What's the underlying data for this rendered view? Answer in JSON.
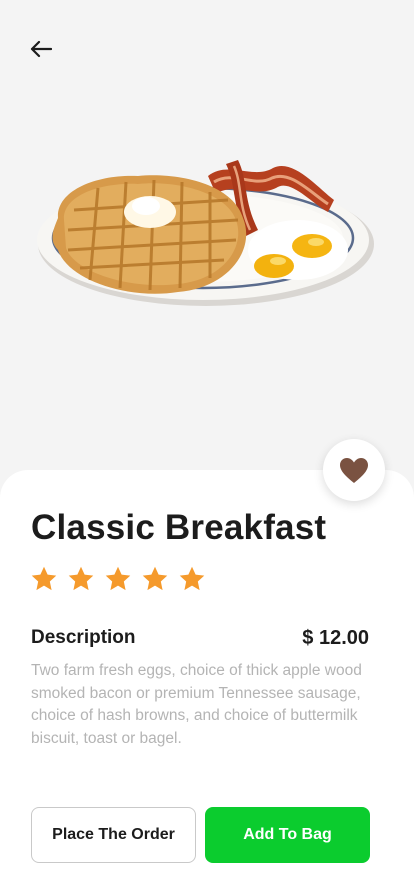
{
  "header": {
    "back_icon": "arrow-left-icon"
  },
  "product": {
    "title": "Classic Breakfast",
    "rating": 5,
    "rating_max": 5,
    "description_label": "Description",
    "price": "$ 12.00",
    "description": "Two farm fresh eggs, choice of thick apple wood smoked bacon or premium Tennessee sausage, choice of hash browns, and choice of buttermilk biscuit, toast or bagel."
  },
  "favorite": {
    "icon": "heart-icon",
    "color": "#7a5241"
  },
  "actions": {
    "place_order_label": "Place The Order",
    "add_to_bag_label": "Add To Bag",
    "add_to_bag_color": "#0bcc2e"
  },
  "colors": {
    "star": "#f59a2c",
    "text_dark": "#1c1c1c",
    "text_muted": "#b4b4b4"
  }
}
